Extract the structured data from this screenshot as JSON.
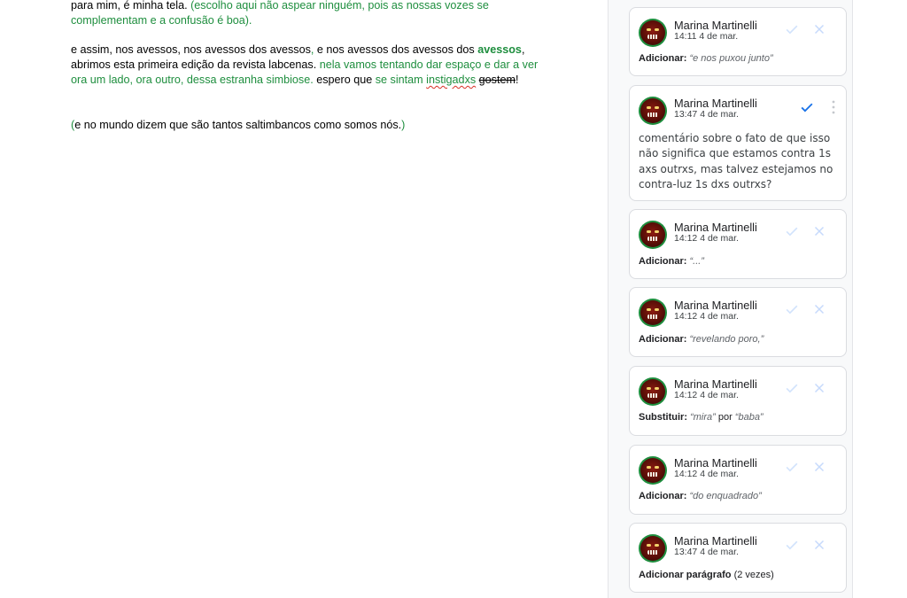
{
  "document": {
    "p1": {
      "t1": "para mim, é minha tela. ",
      "t2": "(escolho aqui não aspear ninguém, pois as nossas vozes se complementam e a confusão é boa)."
    },
    "p2": {
      "t1": "e assim, nos avessos, nos avessos dos avessos",
      "t2": ",",
      "t3": " e nos avessos dos avessos dos ",
      "t4": "avessos",
      "t5": ", abrimos esta primeira edição da revista labcenas. ",
      "t6": "nela vamos tentando dar espaço e dar a ver ora um lado, ora outro, dessa estranha simbiose.",
      "t7": " espero que ",
      "t8": "se sintam ",
      "t9": "instigadxs",
      "t10": " ",
      "t11": "gostem",
      "t12": "!"
    },
    "p3": {
      "t1": "(",
      "t2": "e no mundo dizem que são tantos saltimbancos como somos nós.",
      "t3": ")"
    }
  },
  "sidebar": {
    "cards": [
      {
        "author": "Marina Martinelli",
        "time": "14:11 4 de mar.",
        "action": "Adicionar:",
        "quote": "“e nos puxou junto”"
      },
      {
        "author": "Marina Martinelli",
        "time": "13:47 4 de mar.",
        "comment": "comentário sobre o fato de que isso não significa que estamos contra 1s axs outrxs, mas talvez estejamos no contra-luz 1s dxs outrxs?"
      },
      {
        "author": "Marina Martinelli",
        "time": "14:12 4 de mar.",
        "action": "Adicionar:",
        "quote": "“...”"
      },
      {
        "author": "Marina Martinelli",
        "time": "14:12 4 de mar.",
        "action": "Adicionar:",
        "quote": "“revelando poro,”"
      },
      {
        "author": "Marina Martinelli",
        "time": "14:12 4 de mar.",
        "action": "Substituir:",
        "quote": "“mira”",
        "connector": " por ",
        "quote2": "“baba”"
      },
      {
        "author": "Marina Martinelli",
        "time": "14:12 4 de mar.",
        "action": "Adicionar:",
        "quote": "“do enquadrado”"
      },
      {
        "author": "Marina Martinelli",
        "time": "13:47 4 de mar.",
        "action": "Adicionar parágrafo",
        "extra": " (2 vezes)"
      }
    ]
  },
  "colors": {
    "suggestion_green": "#1e8e3e",
    "accept_blue": "#1a73e8",
    "accept_faded": "#d2e3fc",
    "reject_faded": "#c6dafc"
  },
  "icons": [
    "checkmark-icon",
    "close-icon",
    "more-vert-icon",
    "avatar"
  ]
}
